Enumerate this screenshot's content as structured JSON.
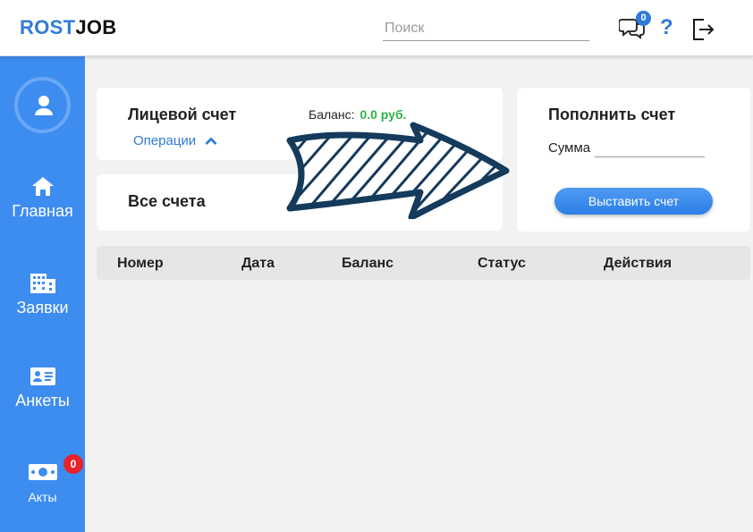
{
  "header": {
    "logo_part1": "ROST",
    "logo_part2": "JOB",
    "search_placeholder": "Поиск",
    "chat_badge": "0",
    "help_label": "?"
  },
  "sidebar": {
    "items": [
      {
        "label": "Главная",
        "icon": "home-icon"
      },
      {
        "label": "Заявки",
        "icon": "building-icon"
      },
      {
        "label": "Анкеты",
        "icon": "id-card-icon"
      },
      {
        "label": "Акты",
        "icon": "money-icon",
        "badge": "0"
      }
    ]
  },
  "account": {
    "title": "Лицевой счет",
    "balance_label": "Баланс:",
    "balance_value": "0.0 руб.",
    "operations_link": "Операции"
  },
  "all_accounts": {
    "title": "Все счета"
  },
  "topup": {
    "title": "Пополнить счет",
    "sum_label": "Сумма",
    "invoice_button": "Выставить счет"
  },
  "table": {
    "columns": [
      "Номер",
      "Дата",
      "Баланс",
      "Статус",
      "Действия"
    ]
  },
  "colors": {
    "accent": "#2f7bd8",
    "sidebar": "#3d8cf0",
    "balance_green": "#2db24a",
    "badge_red": "#e8222b",
    "arrow_navy": "#143a5c"
  }
}
